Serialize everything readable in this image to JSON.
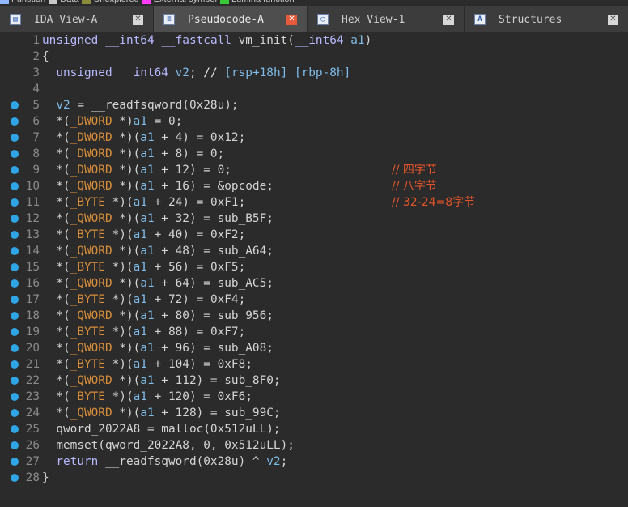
{
  "legend": [
    {
      "label": "Function",
      "color": "#8fb8ff"
    },
    {
      "label": "Data",
      "color": "#c8c8c8"
    },
    {
      "label": "Unexplored",
      "color": "#8a8a3c"
    },
    {
      "label": "External symbol",
      "color": "#ff3cff"
    },
    {
      "label": "Lumina function",
      "color": "#38c838"
    }
  ],
  "tabs": [
    {
      "label": "IDA View-A",
      "icon": "ida-view-icon",
      "active": false
    },
    {
      "label": "Pseudocode-A",
      "icon": "pseudocode-icon",
      "active": true
    },
    {
      "label": "Hex View-1",
      "icon": "hex-view-icon",
      "active": false
    },
    {
      "label": "Structures",
      "icon": "structures-icon",
      "active": false
    }
  ],
  "close_glyph": "✕",
  "lines": [
    {
      "n": "1",
      "bp": false,
      "code": "unsigned __int64 __fastcall vm_init(__int64 a1)",
      "comment": ""
    },
    {
      "n": "2",
      "bp": false,
      "code": "{",
      "comment": ""
    },
    {
      "n": "3",
      "bp": false,
      "code": "  unsigned __int64 v2; // [rsp+18h] [rbp-8h]",
      "comment": ""
    },
    {
      "n": "4",
      "bp": false,
      "code": "",
      "comment": ""
    },
    {
      "n": "5",
      "bp": true,
      "code": "  v2 = __readfsqword(0x28u);",
      "comment": ""
    },
    {
      "n": "6",
      "bp": true,
      "code": "  *(_DWORD *)a1 = 0;",
      "comment": ""
    },
    {
      "n": "7",
      "bp": true,
      "code": "  *(_DWORD *)(a1 + 4) = 0x12;",
      "comment": ""
    },
    {
      "n": "8",
      "bp": true,
      "code": "  *(_DWORD *)(a1 + 8) = 0;",
      "comment": ""
    },
    {
      "n": "9",
      "bp": true,
      "code": "  *(_DWORD *)(a1 + 12) = 0;",
      "comment": "// 四字节"
    },
    {
      "n": "10",
      "bp": true,
      "code": "  *(_QWORD *)(a1 + 16) = &opcode;",
      "comment": "// 八字节"
    },
    {
      "n": "11",
      "bp": true,
      "code": "  *(_BYTE *)(a1 + 24) = 0xF1;",
      "comment": "// 32-24=8字节"
    },
    {
      "n": "12",
      "bp": true,
      "code": "  *(_QWORD *)(a1 + 32) = sub_B5F;",
      "comment": ""
    },
    {
      "n": "13",
      "bp": true,
      "code": "  *(_BYTE *)(a1 + 40) = 0xF2;",
      "comment": ""
    },
    {
      "n": "14",
      "bp": true,
      "code": "  *(_QWORD *)(a1 + 48) = sub_A64;",
      "comment": ""
    },
    {
      "n": "15",
      "bp": true,
      "code": "  *(_BYTE *)(a1 + 56) = 0xF5;",
      "comment": ""
    },
    {
      "n": "16",
      "bp": true,
      "code": "  *(_QWORD *)(a1 + 64) = sub_AC5;",
      "comment": ""
    },
    {
      "n": "17",
      "bp": true,
      "code": "  *(_BYTE *)(a1 + 72) = 0xF4;",
      "comment": ""
    },
    {
      "n": "18",
      "bp": true,
      "code": "  *(_QWORD *)(a1 + 80) = sub_956;",
      "comment": ""
    },
    {
      "n": "19",
      "bp": true,
      "code": "  *(_BYTE *)(a1 + 88) = 0xF7;",
      "comment": ""
    },
    {
      "n": "20",
      "bp": true,
      "code": "  *(_QWORD *)(a1 + 96) = sub_A08;",
      "comment": ""
    },
    {
      "n": "21",
      "bp": true,
      "code": "  *(_BYTE *)(a1 + 104) = 0xF8;",
      "comment": ""
    },
    {
      "n": "22",
      "bp": true,
      "code": "  *(_QWORD *)(a1 + 112) = sub_8F0;",
      "comment": ""
    },
    {
      "n": "23",
      "bp": true,
      "code": "  *(_BYTE *)(a1 + 120) = 0xF6;",
      "comment": ""
    },
    {
      "n": "24",
      "bp": true,
      "code": "  *(_QWORD *)(a1 + 128) = sub_99C;",
      "comment": ""
    },
    {
      "n": "25",
      "bp": true,
      "code": "  qword_2022A8 = malloc(0x512uLL);",
      "comment": ""
    },
    {
      "n": "26",
      "bp": true,
      "code": "  memset(qword_2022A8, 0, 0x512uLL);",
      "comment": ""
    },
    {
      "n": "27",
      "bp": true,
      "code": "  return __readfsqword(0x28u) ^ v2;",
      "comment": ""
    },
    {
      "n": "28",
      "bp": true,
      "code": "}",
      "comment": ""
    }
  ]
}
